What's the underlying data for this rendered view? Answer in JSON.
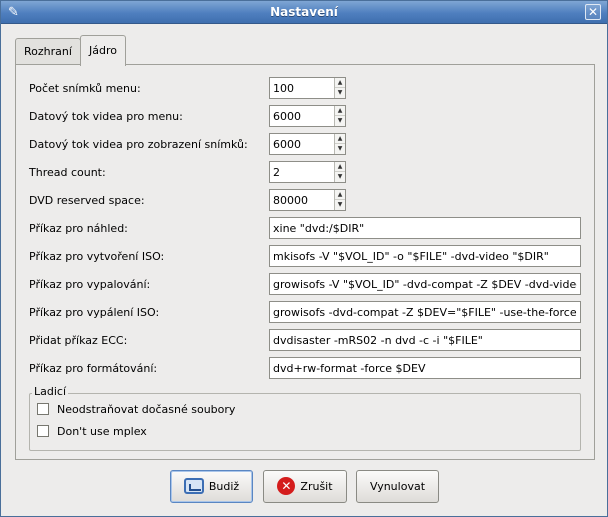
{
  "window": {
    "title": "Nastavení"
  },
  "tabs": [
    {
      "label": "Rozhraní",
      "active": false
    },
    {
      "label": "Jádro",
      "active": true
    }
  ],
  "settings": {
    "menu_frames": {
      "label": "Počet snímků menu:",
      "value": "100"
    },
    "menu_bitrate": {
      "label": "Datový tok videa pro menu:",
      "value": "6000"
    },
    "slideshow_bitrate": {
      "label": "Datový tok videa pro zobrazení snímků:",
      "value": "6000"
    },
    "thread_count": {
      "label": "Thread count:",
      "value": "2"
    },
    "dvd_reserved": {
      "label": "DVD reserved space:",
      "value": "80000"
    },
    "preview_cmd": {
      "label": "Příkaz pro náhled:",
      "value": "xine \"dvd:/$DIR\""
    },
    "iso_cmd": {
      "label": "Příkaz pro vytvoření ISO:",
      "value": "mkisofs -V \"$VOL_ID\" -o \"$FILE\" -dvd-video \"$DIR\""
    },
    "burn_cmd": {
      "label": "Příkaz pro vypalování:",
      "value": "growisofs -V \"$VOL_ID\" -dvd-compat -Z $DEV -dvd-video \"$DIR\""
    },
    "burn_iso_cmd": {
      "label": "Příkaz pro vypálení ISO:",
      "value": "growisofs -dvd-compat -Z $DEV=\"$FILE\" -use-the-force-luke=dao"
    },
    "ecc_cmd": {
      "label": "Přidat příkaz ECC:",
      "value": "dvdisaster -mRS02 -n dvd -c -i \"$FILE\""
    },
    "format_cmd": {
      "label": "Příkaz pro formátování:",
      "value": "dvd+rw-format -force $DEV"
    }
  },
  "debug": {
    "title": "Ladicí",
    "keep_temp": {
      "label": "Neodstraňovat dočasné soubory",
      "checked": false
    },
    "no_mplex": {
      "label": "Don't use mplex",
      "checked": false
    }
  },
  "buttons": {
    "ok": {
      "label": "Budiž",
      "icon": "ok-icon"
    },
    "cancel": {
      "label": "Zrušit",
      "icon": "cancel-icon"
    },
    "reset": {
      "label": "Vynulovat"
    }
  },
  "colors": {
    "titlebar": "#4f7fbf",
    "window_bg": "#edeceb",
    "cancel_icon": "#d41c1c"
  }
}
